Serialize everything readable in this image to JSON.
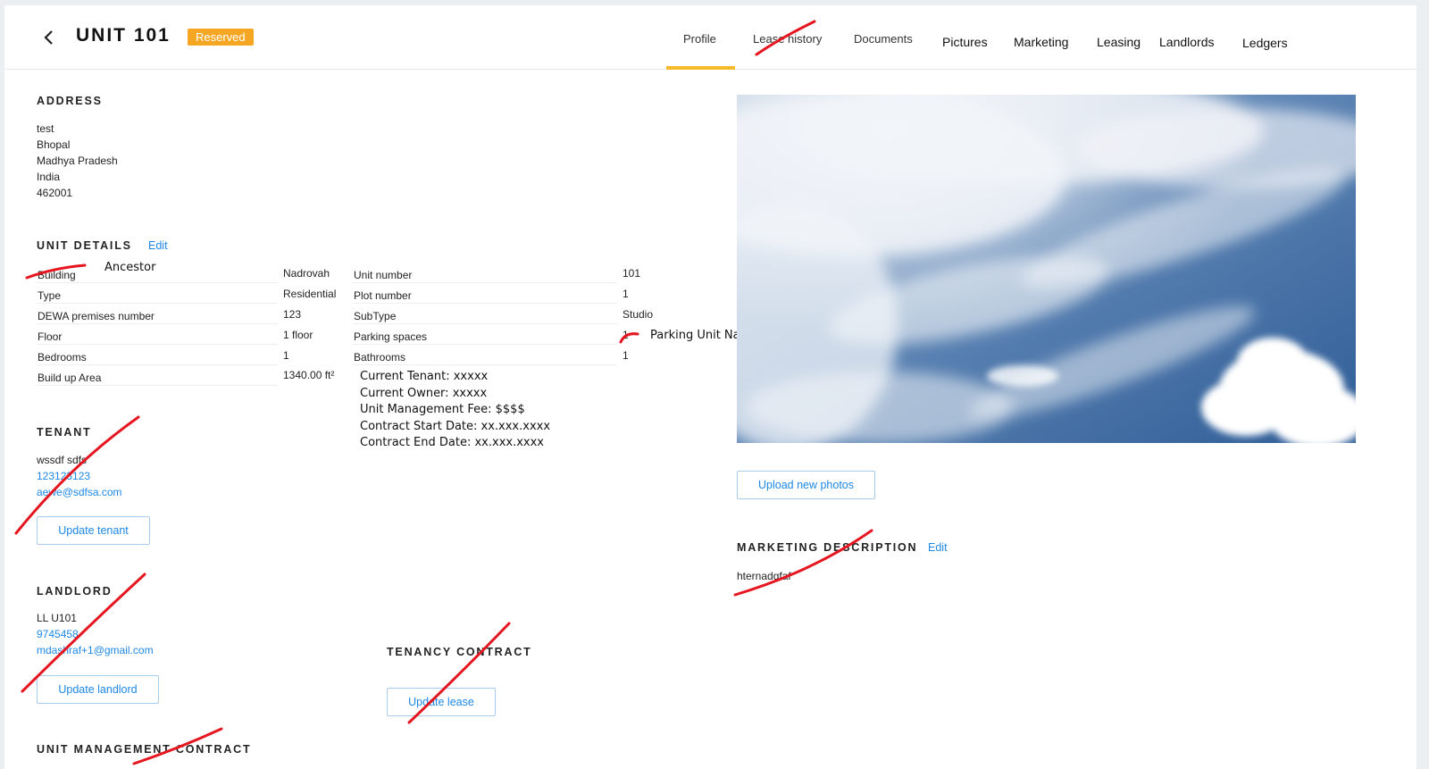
{
  "header": {
    "title": "UNIT 101",
    "badge": "Reserved",
    "tabs": [
      {
        "label": "Profile"
      },
      {
        "label": "Lease history"
      },
      {
        "label": "Documents"
      },
      {
        "label": "Pictures"
      },
      {
        "label": "Marketing"
      },
      {
        "label": "Leasing"
      },
      {
        "label": "Landlords"
      },
      {
        "label": "Ledgers"
      }
    ],
    "active_tab": "Profile"
  },
  "address": {
    "heading": "ADDRESS",
    "lines": [
      "test",
      "Bhopal",
      "Madhya Pradesh",
      "India",
      "462001"
    ]
  },
  "unit_details": {
    "heading": "UNIT DETAILS",
    "edit_label": "Edit",
    "annotation": "Ancestor",
    "left": [
      {
        "key": "Building",
        "value": "Nadrovah"
      },
      {
        "key": "Type",
        "value": "Residential"
      },
      {
        "key": "DEWA premises number",
        "value": "123"
      },
      {
        "key": "Floor",
        "value": "1 floor"
      },
      {
        "key": "Bedrooms",
        "value": "1"
      },
      {
        "key": "Build up Area",
        "value": "1340.00 ft²"
      }
    ],
    "right": [
      {
        "key": "Unit number",
        "value": "101"
      },
      {
        "key": "Plot number",
        "value": "1"
      },
      {
        "key": "SubType",
        "value": "Studio"
      },
      {
        "key": "Parking spaces",
        "value": "1"
      },
      {
        "key": "Bathrooms",
        "value": "1"
      }
    ],
    "parking_annotation": "Parking Unit Names"
  },
  "added_notes": [
    "Current Tenant: xxxxx",
    "Current Owner: xxxxx",
    "Unit Management Fee: $$$$",
    "Contract Start Date: xx.xxx.xxxx",
    "Contract End Date: xx.xxx.xxxx"
  ],
  "tenant": {
    "heading": "TENANT",
    "name": "wssdf sdfs",
    "phone": "123123123",
    "email": "aewe@sdfsa.com",
    "button": "Update tenant"
  },
  "landlord": {
    "heading": "LANDLORD",
    "name": "LL U101",
    "phone": "9745458",
    "email": "mdashraf+1@gmail.com",
    "button": "Update landlord"
  },
  "tenancy_contract": {
    "heading": "TENANCY CONTRACT",
    "button": "Update lease"
  },
  "unit_management_contract": {
    "heading": "UNIT MANAGEMENT CONTRACT"
  },
  "photos": {
    "button": "Upload new photos"
  },
  "marketing": {
    "heading": "MARKETING DESCRIPTION",
    "edit_label": "Edit",
    "text": "hternadgfaf"
  },
  "colors": {
    "accent_blue": "#1e88e5",
    "badge_orange": "#f5a623",
    "tab_underline": "#f5b92a",
    "annotation_red": "#e5161f"
  }
}
